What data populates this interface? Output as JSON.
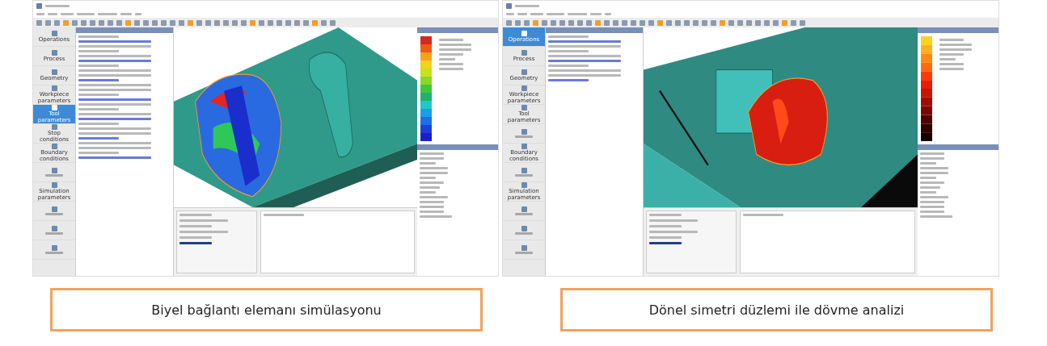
{
  "screenshots": [
    {
      "kind": "rainbow",
      "sidebar": [
        {
          "label": "Operations",
          "selected": false
        },
        {
          "label": "Process",
          "selected": false
        },
        {
          "label": "Geometry",
          "selected": false
        },
        {
          "label": "Workpiece parameters",
          "selected": false
        },
        {
          "label": "Tool parameters",
          "selected": true
        },
        {
          "label": "Stop conditions",
          "selected": false
        },
        {
          "label": "Boundary conditions",
          "selected": false
        },
        {
          "selected": false
        },
        {
          "label": "Simulation parameters",
          "selected": false
        },
        {
          "selected": false
        },
        {
          "selected": false
        },
        {
          "selected": false
        }
      ],
      "caption": "Biyel bağlantı elemanı simülasyonu"
    },
    {
      "kind": "heat",
      "sidebar": [
        {
          "label": "Operations",
          "selected": true
        },
        {
          "label": "Process",
          "selected": false
        },
        {
          "label": "Geometry",
          "selected": false
        },
        {
          "label": "Workpiece parameters",
          "selected": false
        },
        {
          "label": "Tool parameters",
          "selected": false
        },
        {
          "selected": false
        },
        {
          "label": "Boundary conditions",
          "selected": false
        },
        {
          "selected": false
        },
        {
          "label": "Simulation parameters",
          "selected": false
        },
        {
          "selected": false
        },
        {
          "selected": false
        },
        {
          "selected": false
        }
      ],
      "caption": "Dönel simetri düzlemi ile dövme analizi"
    }
  ]
}
